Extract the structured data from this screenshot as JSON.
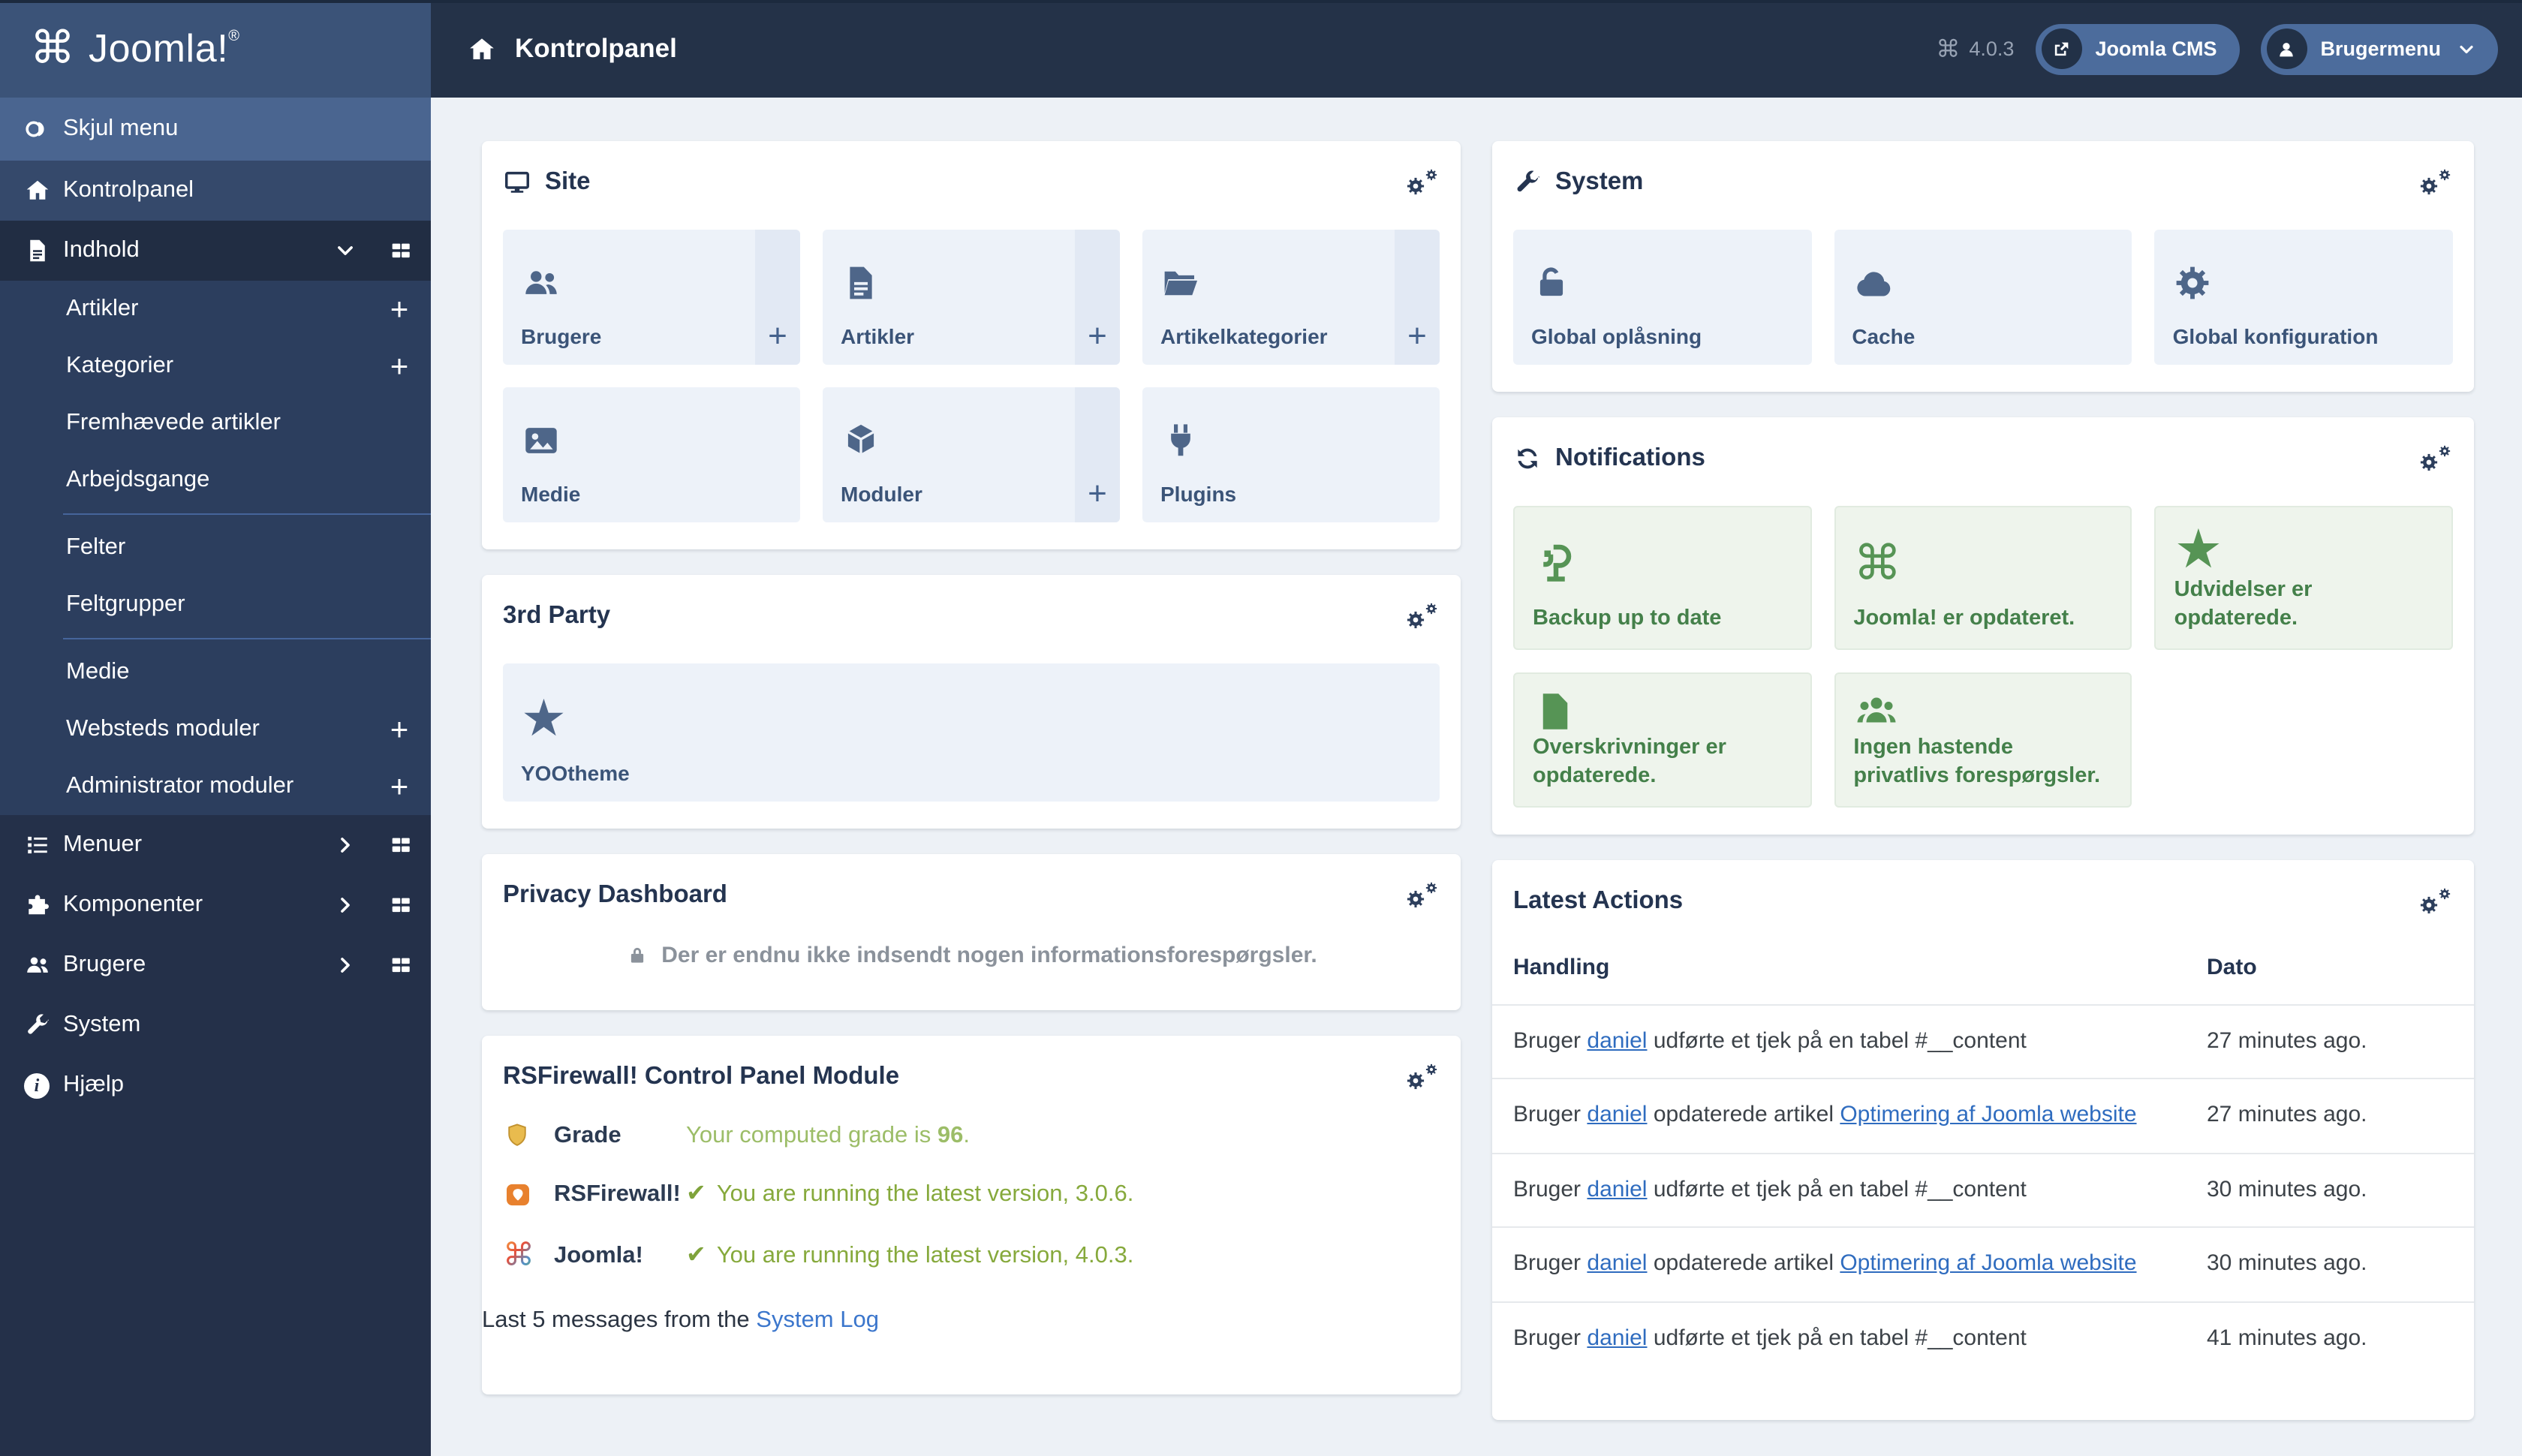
{
  "colors": {
    "topbar_bg": "#243248",
    "sidebar_bg": "#243049",
    "sidebar_logo_bg": "#3b5378",
    "sidebar_toggle_bg": "#4a6590",
    "active_item_bg": "#212d43",
    "content_bg": "#edf1f6",
    "panel_title": "#243450",
    "card_bg": "#edf2f9",
    "card_icon": "#4e6689",
    "notification_bg": "#eef4ec",
    "notification_green": "#44804a",
    "link_blue": "#2f6cbf",
    "olive_green": "#86a93c",
    "grade_green": "#9cbd68"
  },
  "topbar": {
    "logo_text": "Joomla!",
    "logo_reg": "®",
    "page_title": "Kontrolpanel",
    "version": "4.0.3",
    "cms_button": "Joomla CMS",
    "user_button": "Brugermenu"
  },
  "sidebar": {
    "toggle_label": "Skjul menu",
    "items": [
      {
        "label": "Kontrolpanel",
        "icon": "home-icon"
      },
      {
        "label": "Indhold",
        "icon": "document-icon",
        "expanded": true
      }
    ],
    "submenu": [
      {
        "label": "Artikler",
        "has_add": true
      },
      {
        "label": "Kategorier",
        "has_add": true
      },
      {
        "label": "Fremhævede artikler"
      },
      {
        "label": "Arbejdsgange"
      },
      {
        "label": "Felter"
      },
      {
        "label": "Feltgrupper"
      },
      {
        "label": "Medie"
      },
      {
        "label": "Websteds moduler",
        "has_add": true
      },
      {
        "label": "Administrator moduler",
        "has_add": true
      }
    ],
    "bottom_items": [
      {
        "label": "Menuer",
        "icon": "list-icon",
        "has_chevron": true,
        "has_grid": true
      },
      {
        "label": "Komponenter",
        "icon": "puzzle-icon",
        "has_chevron": true,
        "has_grid": true
      },
      {
        "label": "Brugere",
        "icon": "users-icon",
        "has_chevron": true,
        "has_grid": true
      },
      {
        "label": "System",
        "icon": "wrench-icon"
      },
      {
        "label": "Hjælp",
        "icon": "info-icon"
      }
    ]
  },
  "site_panel": {
    "title": "Site",
    "header_icon": "monitor-icon",
    "cards": [
      {
        "label": "Brugere",
        "icon": "users-icon",
        "has_add": true
      },
      {
        "label": "Artikler",
        "icon": "article-icon",
        "has_add": true
      },
      {
        "label": "Artikelkategorier",
        "icon": "folder-open-icon",
        "has_add": true
      },
      {
        "label": "Medie",
        "icon": "image-icon"
      },
      {
        "label": "Moduler",
        "icon": "cube-icon",
        "has_add": true
      },
      {
        "label": "Plugins",
        "icon": "plug-icon"
      }
    ]
  },
  "third_party_panel": {
    "title": "3rd Party",
    "cards": [
      {
        "label": "YOOtheme",
        "icon": "star-icon"
      }
    ]
  },
  "privacy_panel": {
    "title": "Privacy Dashboard",
    "message": "Der er endnu ikke indsendt nogen informationsforespørgsler."
  },
  "rsfirewall_panel": {
    "title": "RSFirewall! Control Panel Module",
    "rows": [
      {
        "label": "Grade",
        "icon": "shield-icon",
        "message_prefix": "Your computed grade is ",
        "value": "96",
        "suffix": "."
      },
      {
        "label": "RSFirewall!",
        "icon": "rsfirewall-icon",
        "message": "You are running the latest version, 3.0.6."
      },
      {
        "label": "Joomla!",
        "icon": "joomla-icon",
        "message": "You are running the latest version, 4.0.3."
      }
    ],
    "footer_text": "Last 5 messages from the ",
    "footer_link": "System Log"
  },
  "system_panel": {
    "title": "System",
    "header_icon": "wrench-icon",
    "cards": [
      {
        "label": "Global oplåsning",
        "icon": "unlock-icon"
      },
      {
        "label": "Cache",
        "icon": "cloud-icon"
      },
      {
        "label": "Global konfiguration",
        "icon": "gear-icon"
      }
    ]
  },
  "notifications_panel": {
    "title": "Notifications",
    "header_icon": "sync-icon",
    "cards": [
      {
        "label": "Backup up to date",
        "icon": "backup-icon"
      },
      {
        "label": "Joomla! er opdateret.",
        "icon": "joomla-icon"
      },
      {
        "label": "Udvidelser er opdaterede.",
        "icon": "star-icon"
      },
      {
        "label": "Overskrivninger er opdaterede.",
        "icon": "document-icon"
      },
      {
        "label": "Ingen hastende privatlivs forespørgsler.",
        "icon": "users-icon"
      }
    ]
  },
  "latest_actions_panel": {
    "title": "Latest Actions",
    "columns": [
      "Handling",
      "Dato"
    ],
    "rows": [
      {
        "prefix": "Bruger ",
        "user": "daniel",
        "action": " udførte et tjek på en tabel #__content",
        "date": "27 minutes ago."
      },
      {
        "prefix": "Bruger ",
        "user": "daniel",
        "action": " opdaterede artikel ",
        "article": "Optimering af Joomla website",
        "date": "27 minutes ago."
      },
      {
        "prefix": "Bruger ",
        "user": "daniel",
        "action": " udførte et tjek på en tabel #__content",
        "date": "30 minutes ago."
      },
      {
        "prefix": "Bruger ",
        "user": "daniel",
        "action": " opdaterede artikel ",
        "article": "Optimering af Joomla website",
        "date": "30 minutes ago."
      },
      {
        "prefix": "Bruger ",
        "user": "daniel",
        "action": " udførte et tjek på en tabel #__content",
        "date": "41 minutes ago."
      }
    ]
  }
}
